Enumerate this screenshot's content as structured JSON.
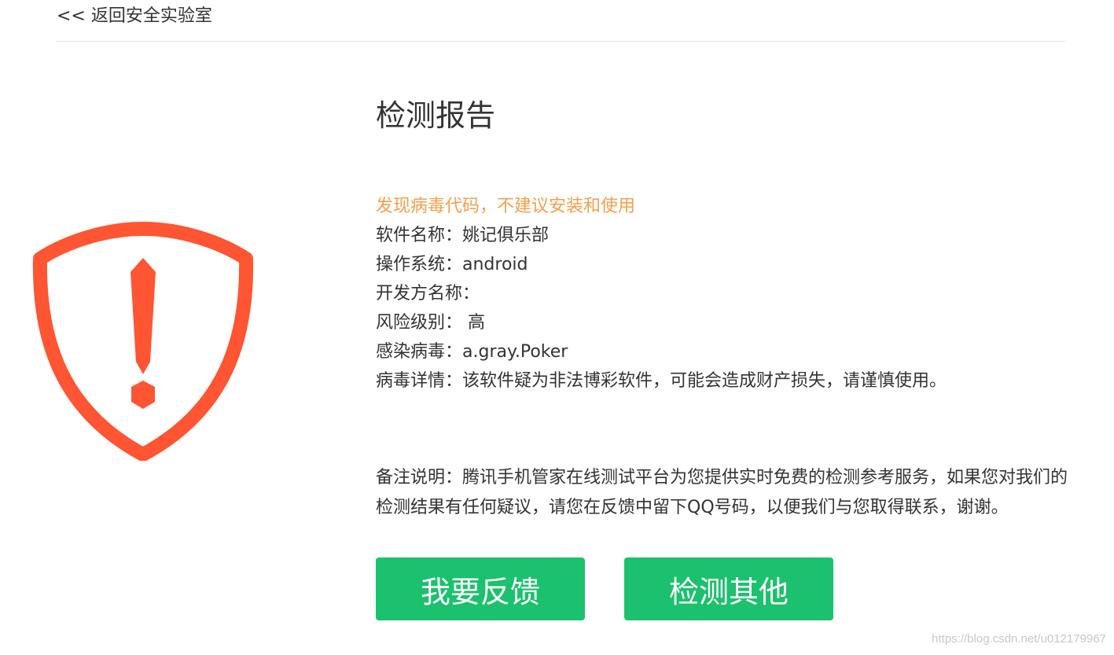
{
  "nav": {
    "back_label": "<< 返回安全实验室"
  },
  "report": {
    "title": "检测报告",
    "warning": "发现病毒代码，不建议安装和使用",
    "rows": [
      "软件名称：姚记俱乐部",
      "操作系统：android",
      "开发方名称：",
      "风险级别： 高",
      "感染病毒：a.gray.Poker",
      "病毒详情：该软件疑为非法博彩软件，可能会造成财产损失，请谨慎使用。"
    ],
    "note": "备注说明：腾讯手机管家在线测试平台为您提供实时免费的检测参考服务，如果您对我们的检测结果有任何疑议，请您在反馈中留下QQ号码，以便我们与您取得联系，谢谢。"
  },
  "actions": {
    "feedback_label": "我要反馈",
    "other_label": "检测其他"
  },
  "watermark": "https://blog.csdn.net/u012179967",
  "colors": {
    "danger": "#ff5533",
    "warning": "#f5a04b",
    "button": "#1cc16e",
    "text": "#333333"
  },
  "icons": {
    "shield": "shield-warning-icon"
  }
}
